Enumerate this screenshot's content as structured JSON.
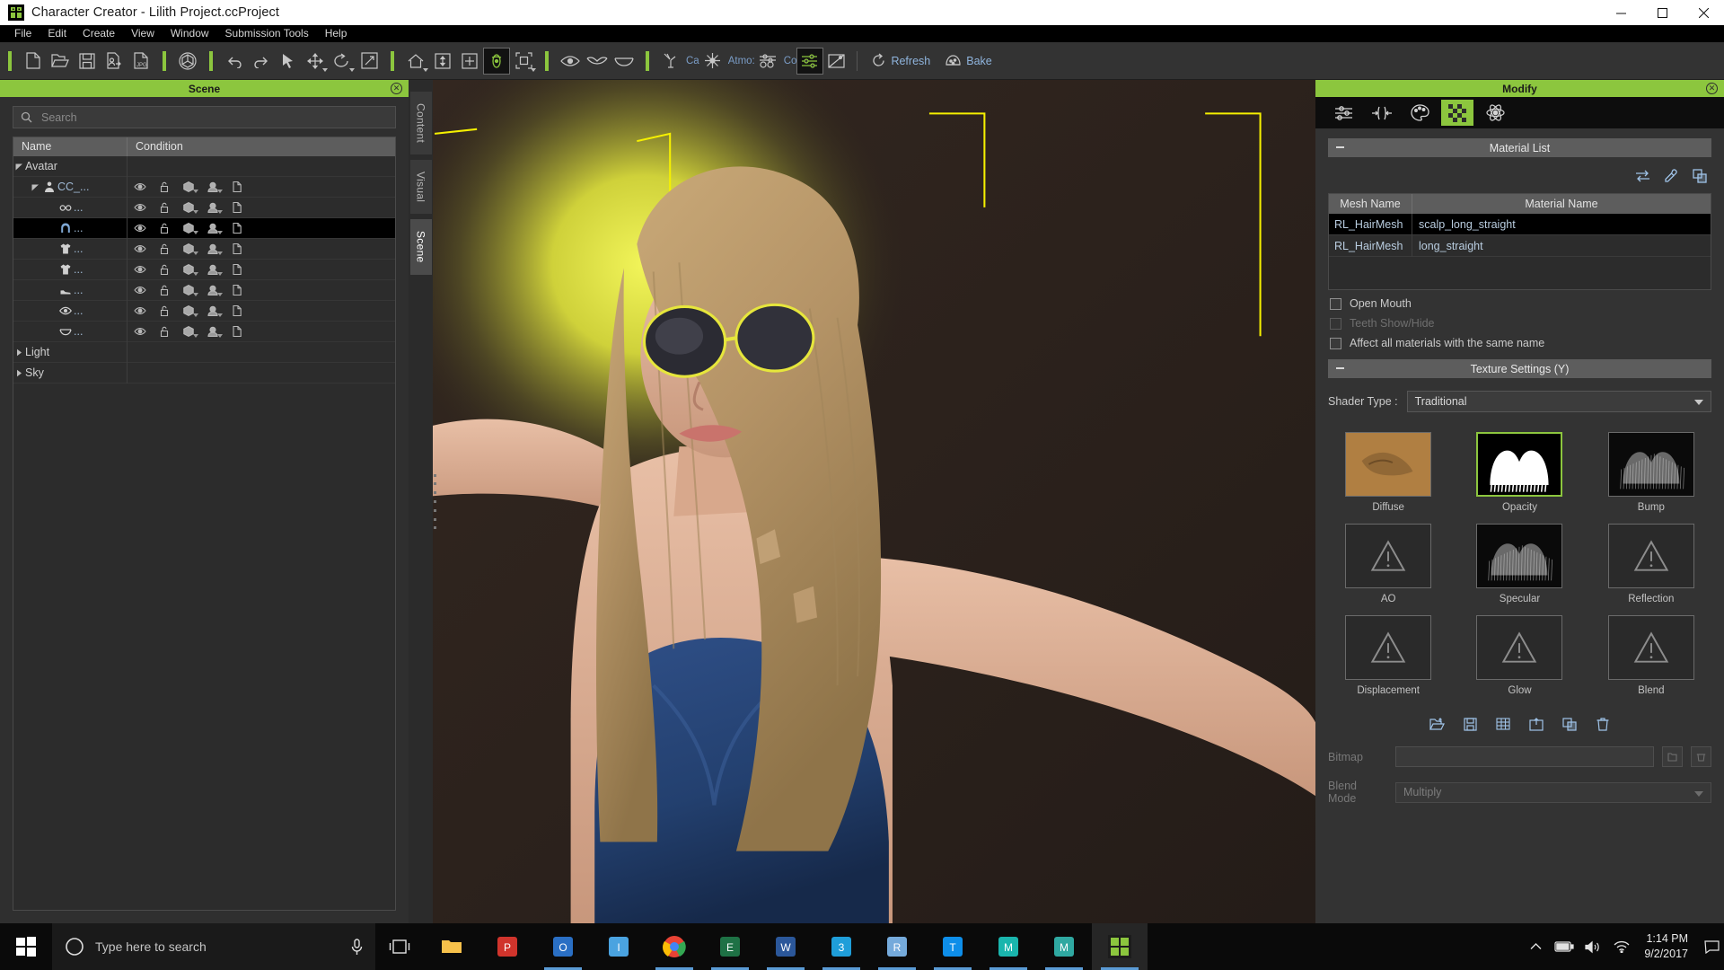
{
  "titlebar": {
    "title": "Character Creator - Lilith Project.ccProject",
    "logo_icon": "app-logo-icon",
    "minimize_icon": "minimize-icon",
    "maximize_icon": "maximize-icon",
    "close_icon": "close-icon"
  },
  "menubar": {
    "items": [
      {
        "label": "File"
      },
      {
        "label": "Edit"
      },
      {
        "label": "Create"
      },
      {
        "label": "View"
      },
      {
        "label": "Window"
      },
      {
        "label": "Submission Tools"
      },
      {
        "label": "Help"
      }
    ]
  },
  "toolbar": {
    "groups": [
      {
        "icons": [
          {
            "name": "new-project-icon"
          },
          {
            "name": "open-project-icon"
          },
          {
            "name": "save-project-icon"
          },
          {
            "name": "import-avatar-icon"
          },
          {
            "name": "export-file-icon"
          }
        ]
      },
      {
        "icons": [
          {
            "name": "content-browser-icon"
          }
        ]
      },
      {
        "icons": [
          {
            "name": "undo-icon"
          },
          {
            "name": "redo-icon"
          },
          {
            "name": "select-tool-icon"
          },
          {
            "name": "move-tool-icon",
            "caret": true
          },
          {
            "name": "rotate-tool-icon",
            "caret": true
          },
          {
            "name": "scale-tool-icon"
          }
        ]
      },
      {
        "icons": [
          {
            "name": "home-view-icon",
            "caret": true
          },
          {
            "name": "fit-view-icon"
          },
          {
            "name": "pan-view-icon"
          },
          {
            "name": "orbit-view-icon",
            "active": true
          },
          {
            "name": "frame-object-icon",
            "caret": true
          }
        ]
      },
      {
        "icons": [
          {
            "name": "eye-preview-icon"
          },
          {
            "name": "eyebrow-preview-icon"
          },
          {
            "name": "mouth-preview-icon"
          }
        ]
      },
      {
        "labeled": [
          {
            "name": "camera-settings-icon",
            "label": "Ca"
          },
          {
            "name": "atmosphere-icon",
            "label": "Atmo:"
          },
          {
            "name": "color-settings-icon",
            "label": "Co"
          },
          {
            "name": "render-settings-icon",
            "active": true
          },
          {
            "name": "toggle-display-icon"
          }
        ]
      }
    ],
    "refresh_label": "Refresh",
    "refresh_icon": "refresh-icon",
    "bake_label": "Bake",
    "bake_icon": "bake-icon"
  },
  "scene_panel": {
    "title": "Scene",
    "close_icon": "close-icon",
    "search": {
      "placeholder": "Search",
      "value": "",
      "icon": "search-icon"
    },
    "columns": {
      "name": "Name",
      "condition": "Condition"
    },
    "rows": [
      {
        "label": "Avatar",
        "icon": "",
        "indent": 0,
        "arrow": "open",
        "plain": true,
        "has_condition": false,
        "selected": false
      },
      {
        "label": "CC_...",
        "icon": "person-icon",
        "indent": 1,
        "arrow": "open",
        "plain": false,
        "has_condition": true,
        "selected": false
      },
      {
        "label": "...",
        "icon": "glasses-icon",
        "indent": 2,
        "arrow": "",
        "plain": false,
        "has_condition": true,
        "selected": false
      },
      {
        "label": "...",
        "icon": "hair-icon",
        "indent": 2,
        "arrow": "",
        "plain": false,
        "has_condition": true,
        "selected": true
      },
      {
        "label": "...",
        "icon": "shirt-icon",
        "indent": 2,
        "arrow": "",
        "plain": false,
        "has_condition": true,
        "selected": false
      },
      {
        "label": "...",
        "icon": "shirt-icon",
        "indent": 2,
        "arrow": "",
        "plain": false,
        "has_condition": true,
        "selected": false
      },
      {
        "label": "...",
        "icon": "shoe-icon",
        "indent": 2,
        "arrow": "",
        "plain": false,
        "has_condition": true,
        "selected": false
      },
      {
        "label": "...",
        "icon": "eye-icon",
        "indent": 2,
        "arrow": "",
        "plain": false,
        "has_condition": true,
        "selected": false
      },
      {
        "label": "...",
        "icon": "mouth-icon",
        "indent": 2,
        "arrow": "",
        "plain": false,
        "has_condition": true,
        "selected": false
      },
      {
        "label": "Light",
        "icon": "",
        "indent": 0,
        "arrow": "closed",
        "plain": true,
        "has_condition": false,
        "selected": false
      },
      {
        "label": "Sky",
        "icon": "",
        "indent": 0,
        "arrow": "closed",
        "plain": true,
        "has_condition": false,
        "selected": false
      }
    ],
    "condition_icons": [
      {
        "name": "visibility-eye-icon",
        "caret": false
      },
      {
        "name": "lock-icon",
        "caret": false
      },
      {
        "name": "mesh-cube-icon",
        "caret": true
      },
      {
        "name": "material-sphere-icon",
        "caret": true
      },
      {
        "name": "page-icon",
        "caret": false
      }
    ]
  },
  "vertical_tabs": {
    "items": [
      {
        "label": "Content",
        "active": false
      },
      {
        "label": "Visual",
        "active": false
      },
      {
        "label": "Scene",
        "active": true
      }
    ]
  },
  "modify_panel": {
    "title": "Modify",
    "close_icon": "close-icon",
    "tabs": [
      {
        "name": "adjust-sliders-tab",
        "active": false
      },
      {
        "name": "morph-tab",
        "active": false
      },
      {
        "name": "appearance-tab",
        "active": false
      },
      {
        "name": "material-tab",
        "active": true
      },
      {
        "name": "physics-tab",
        "active": false
      }
    ],
    "material_list": {
      "title": "Material List",
      "tools": [
        {
          "name": "swap-material-icon"
        },
        {
          "name": "eyedropper-icon"
        },
        {
          "name": "duplicate-material-icon"
        }
      ],
      "columns": {
        "mesh": "Mesh Name",
        "material": "Material Name"
      },
      "rows": [
        {
          "mesh": "RL_HairMesh",
          "material": "scalp_long_straight",
          "selected": true
        },
        {
          "mesh": "RL_HairMesh",
          "material": "long_straight",
          "selected": false
        }
      ]
    },
    "checkboxes": [
      {
        "label": "Open Mouth",
        "checked": false,
        "disabled": false
      },
      {
        "label": "Teeth Show/Hide",
        "checked": false,
        "disabled": true
      },
      {
        "label": "Affect all materials with the same name",
        "checked": false,
        "disabled": false
      }
    ],
    "texture_settings": {
      "title": "Texture Settings  (Y)",
      "shader_label": "Shader Type :",
      "shader_value": "Traditional",
      "channels": [
        {
          "label": "Diffuse",
          "state": "image-diffuse",
          "selected": false
        },
        {
          "label": "Opacity",
          "state": "image-opacity",
          "selected": true
        },
        {
          "label": "Bump",
          "state": "image-bump",
          "selected": false
        },
        {
          "label": "AO",
          "state": "empty",
          "selected": false
        },
        {
          "label": "Specular",
          "state": "image-specular",
          "selected": false
        },
        {
          "label": "Reflection",
          "state": "empty",
          "selected": false
        },
        {
          "label": "Displacement",
          "state": "empty",
          "selected": false
        },
        {
          "label": "Glow",
          "state": "empty",
          "selected": false
        },
        {
          "label": "Blend",
          "state": "empty",
          "selected": false
        }
      ],
      "tools": [
        {
          "name": "load-texture-icon"
        },
        {
          "name": "save-texture-icon"
        },
        {
          "name": "texture-grid-icon"
        },
        {
          "name": "add-texture-icon"
        },
        {
          "name": "copy-texture-icon"
        },
        {
          "name": "delete-texture-icon"
        }
      ],
      "bitmap_label": "Bitmap",
      "bitmap_value": "",
      "bitmap_buttons": [
        {
          "name": "browse-bitmap-icon"
        },
        {
          "name": "clear-bitmap-icon"
        }
      ],
      "blend_mode_label": "Blend Mode",
      "blend_mode_value": "Multiply"
    },
    "accent_color": "#8cc63e"
  },
  "taskbar": {
    "start_icon": "windows-start-icon",
    "search_placeholder": "Type here to search",
    "search_icon": "cortana-circle-icon",
    "mic_icon": "microphone-icon",
    "taskview_icon": "task-view-icon",
    "apps": [
      {
        "name": "file-explorer-icon",
        "running": false,
        "active": false
      },
      {
        "name": "pdf-reader-icon",
        "running": false,
        "active": false
      },
      {
        "name": "outlook-icon",
        "running": true,
        "active": false
      },
      {
        "name": "internet-explorer-icon",
        "running": false,
        "active": false
      },
      {
        "name": "chrome-icon",
        "running": true,
        "active": false
      },
      {
        "name": "excel-icon",
        "running": true,
        "active": false
      },
      {
        "name": "word-icon",
        "running": true,
        "active": false
      },
      {
        "name": "3ds-max-icon",
        "running": true,
        "active": false
      },
      {
        "name": "r-studio-icon",
        "running": true,
        "active": false
      },
      {
        "name": "teamviewer-icon",
        "running": true,
        "active": false
      },
      {
        "name": "maya-icon",
        "running": true,
        "active": false
      },
      {
        "name": "motionbuilder-icon",
        "running": true,
        "active": false
      },
      {
        "name": "character-creator-icon",
        "running": true,
        "active": true
      }
    ],
    "tray": [
      {
        "name": "show-hidden-icons-chevron"
      },
      {
        "name": "battery-icon"
      },
      {
        "name": "volume-icon"
      },
      {
        "name": "network-icon"
      }
    ],
    "time": "1:14 PM",
    "date": "9/2/2017",
    "notification_icon": "action-center-icon"
  }
}
